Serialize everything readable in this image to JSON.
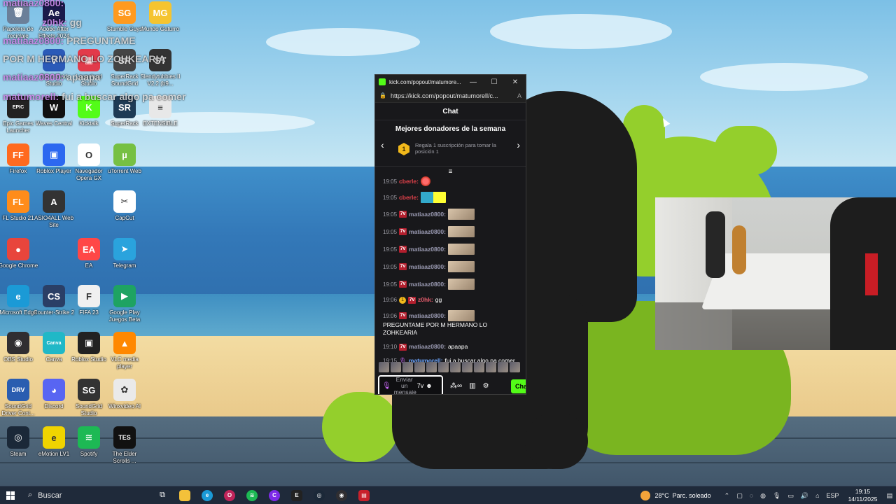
{
  "desktop": {
    "icons": [
      {
        "label": "Papelera de reciclaje",
        "icon": "recycle-bin-icon",
        "color": "#6b7f99",
        "glyph": "🗑"
      },
      {
        "label": "Adobe After Effects 2024",
        "icon": "after-effects-icon",
        "color": "#1a1a4a",
        "glyph": "Ae"
      },
      {
        "label": "Stumble Guys",
        "icon": "stumble-guys-icon",
        "color": "#ff9a1f",
        "glyph": "SG"
      },
      {
        "label": "Mundo Gaturro",
        "icon": "mundo-gaturro-icon",
        "color": "#f5c430",
        "glyph": "MG"
      },
      {
        "label": "SoundGrid Studio",
        "icon": "soundgrid-icon",
        "color": "#2b5ab8",
        "glyph": "V"
      },
      {
        "label": "Loopcloud Studio",
        "icon": "loopcloud-icon",
        "color": "#e23a4a",
        "glyph": "▦"
      },
      {
        "label": "SuperRack SoundGrid",
        "icon": "superrack-soundgrid-icon",
        "color": "#444",
        "glyph": "SR"
      },
      {
        "label": "Slendytubbies II V2.2 (b9...",
        "icon": "slendytubbies-icon",
        "color": "#333",
        "glyph": "ST"
      },
      {
        "label": "Epic Games Launcher",
        "icon": "epic-games-icon",
        "color": "#222",
        "glyph": "EPIC"
      },
      {
        "label": "Waves Central",
        "icon": "waves-central-icon",
        "color": "#111",
        "glyph": "W"
      },
      {
        "label": "Kicktalk",
        "icon": "kicktalk-icon",
        "color": "#53fc18",
        "glyph": "K"
      },
      {
        "label": "SuperRack",
        "icon": "superrack-icon",
        "color": "#1e3b55",
        "glyph": "SR"
      },
      {
        "label": "EXTENSIBLE",
        "icon": "document-icon",
        "color": "#e8e8e8",
        "glyph": "≡"
      },
      {
        "label": "Firefox",
        "icon": "firefox-icon",
        "color": "#ff6a1f",
        "glyph": "FF"
      },
      {
        "label": "Roblox Player",
        "icon": "roblox-player-icon",
        "color": "#2c68f0",
        "glyph": "▣"
      },
      {
        "label": "Navegador Opera GX",
        "icon": "opera-gx-icon",
        "color": "#fff",
        "glyph": "O"
      },
      {
        "label": "uTorrent Web",
        "icon": "utorrent-icon",
        "color": "#76c043",
        "glyph": "µ"
      },
      {
        "label": "FL Studio 21",
        "icon": "fl-studio-icon",
        "color": "#ff8c1a",
        "glyph": "FL"
      },
      {
        "label": "ASIO4ALL Web Site",
        "icon": "asio4all-icon",
        "color": "#333",
        "glyph": "A"
      },
      {
        "label": "CapCut",
        "icon": "capcut-icon",
        "color": "#fff",
        "glyph": "✂"
      },
      {
        "label": "Google Chrome",
        "icon": "chrome-icon",
        "color": "#e8453c",
        "glyph": "●"
      },
      {
        "label": "EA",
        "icon": "ea-icon",
        "color": "#ff4747",
        "glyph": "EA"
      },
      {
        "label": "Telegram",
        "icon": "telegram-icon",
        "color": "#2aa3dd",
        "glyph": "➤"
      },
      {
        "label": "Microsoft Edge",
        "icon": "edge-icon",
        "color": "#1b9ad6",
        "glyph": "e"
      },
      {
        "label": "Counter-Strike 2",
        "icon": "counter-strike-icon",
        "color": "#2a3f66",
        "glyph": "CS"
      },
      {
        "label": "FIFA 23",
        "icon": "fifa-icon",
        "color": "#f0f0f0",
        "glyph": "F"
      },
      {
        "label": "Google Play Juegos Beta",
        "icon": "google-play-games-icon",
        "color": "#1ea362",
        "glyph": "▶"
      },
      {
        "label": "OBS Studio",
        "icon": "obs-icon",
        "color": "#302e31",
        "glyph": "◉"
      },
      {
        "label": "Canva",
        "icon": "canva-icon",
        "color": "#20b8c7",
        "glyph": "Canva"
      },
      {
        "label": "Roblox Studio",
        "icon": "roblox-studio-icon",
        "color": "#222",
        "glyph": "▣"
      },
      {
        "label": "VLC media player",
        "icon": "vlc-icon",
        "color": "#ff8800",
        "glyph": "▲"
      },
      {
        "label": "SoundGrid Driver Cont...",
        "icon": "soundgrid-driver-icon",
        "color": "#2a5db0",
        "glyph": "DRV"
      },
      {
        "label": "Discord",
        "icon": "discord-icon",
        "color": "#5865f2",
        "glyph": "◕"
      },
      {
        "label": "SoundGrid Studio",
        "icon": "soundgrid-studio-icon",
        "color": "#333",
        "glyph": "SG"
      },
      {
        "label": "Winxvideo AI",
        "icon": "winxvideo-icon",
        "color": "#eaeaea",
        "glyph": "✿"
      },
      {
        "label": "Steam",
        "icon": "steam-icon",
        "color": "#1b2838",
        "glyph": "◎"
      },
      {
        "label": "eMotion LV1",
        "icon": "emotion-lv1-icon",
        "color": "#f0d400",
        "glyph": "e"
      },
      {
        "label": "Spotify",
        "icon": "spotify-icon",
        "color": "#1db954",
        "glyph": "≋"
      },
      {
        "label": "The Elder Scrolls ...",
        "icon": "elder-scrolls-icon",
        "color": "#111",
        "glyph": "TES"
      }
    ],
    "overlay_chat": [
      {
        "user": "matiaaz0800:",
        "text": ""
      },
      {
        "user": "z0hk:",
        "text": "gg"
      },
      {
        "user": "matiaaz0800:",
        "text": "PREGUNTAME"
      },
      {
        "user": "",
        "text": "POR M HERMANO LO ZOHKEARIA"
      },
      {
        "user": "matiaaz0800:",
        "text": "apaapa"
      },
      {
        "user": "matumorell:",
        "text": "fui a buscar algo pa comer"
      }
    ]
  },
  "popout": {
    "window_title": "kick.com/popout/matumore...",
    "url": "https://kick.com/popout/matumorell/c...",
    "chat_header": "Chat",
    "donors_title": "Mejores donadores de la semana",
    "donors_rank": "1",
    "donors_text": "Regala 1 suscripción para tomar la posición 1",
    "messages": [
      {
        "time": "19:05",
        "user": "cberle:",
        "user_style": "red",
        "text": "",
        "badge": "",
        "emote": "sm"
      },
      {
        "time": "19:05",
        "user": "cberle:",
        "user_style": "red",
        "text": "",
        "badge": "",
        "emote": "duo"
      },
      {
        "time": "19:05",
        "user": "matiaaz0800:",
        "user_style": "gray",
        "text": "",
        "badge": "7v",
        "emote": "img"
      },
      {
        "time": "19:05",
        "user": "matiaaz0800:",
        "user_style": "gray",
        "text": "",
        "badge": "7v",
        "emote": "img"
      },
      {
        "time": "19:05",
        "user": "matiaaz0800:",
        "user_style": "gray",
        "text": "",
        "badge": "7v",
        "emote": "img"
      },
      {
        "time": "19:05",
        "user": "matiaaz0800:",
        "user_style": "gray",
        "text": "",
        "badge": "7v",
        "emote": "img"
      },
      {
        "time": "19:05",
        "user": "matiaaz0800:",
        "user_style": "gray",
        "text": "",
        "badge": "7v",
        "emote": "img"
      },
      {
        "time": "19:06",
        "user": "z0hk:",
        "user_style": "pink",
        "text": "gg",
        "badge": "7v",
        "emote": ""
      },
      {
        "time": "19:06",
        "user": "matiaaz0800:",
        "user_style": "gray",
        "text": "PREGUNTAME POR M HERMANO LO ZOHKEARIA",
        "badge": "7v",
        "emote": "img"
      },
      {
        "time": "19:10",
        "user": "matiaaz0800:",
        "user_style": "gray",
        "text": "apaapa",
        "badge": "7v",
        "emote": ""
      },
      {
        "time": "19:15",
        "user": "matumorell:",
        "user_style": "blue",
        "text": "fui a buscar algo pa comer",
        "badge": "mic",
        "emote": ""
      }
    ],
    "input_placeholder": "Enviar un mensaje",
    "send_label": "Chat"
  },
  "taskbar": {
    "search_placeholder": "Buscar",
    "weather_temp": "28°C",
    "weather_desc": "Parc. soleado",
    "lang": "ESP",
    "time": "19:15",
    "date": "14/11/2025"
  }
}
